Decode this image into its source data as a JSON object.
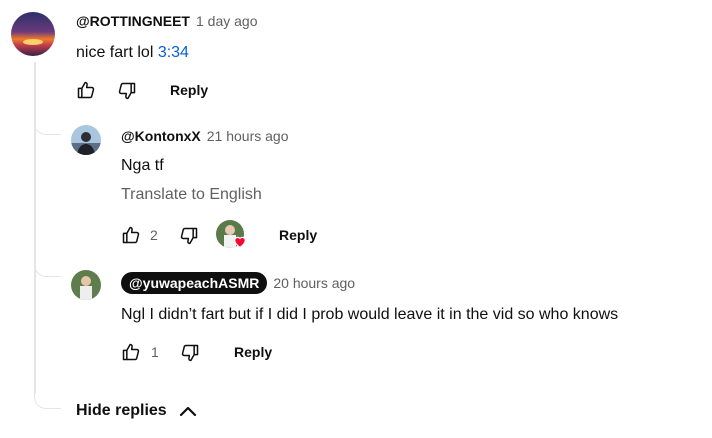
{
  "main_comment": {
    "author": "@ROTTINGNEET",
    "time": "1 day ago",
    "text": "nice fart lol ",
    "timestamp_link": "3:34",
    "reply_label": "Reply"
  },
  "replies": [
    {
      "author": "@KontonxX",
      "time": "21 hours ago",
      "text": "Nga tf",
      "translate": "Translate to English",
      "likes": "2",
      "reply_label": "Reply"
    },
    {
      "author": "@yuwapeachASMR",
      "time": "20 hours ago",
      "text": "Ngl I didn’t fart but if I did I prob would leave it in the vid so who knows",
      "likes": "1",
      "reply_label": "Reply"
    }
  ],
  "hide_replies": "Hide replies",
  "colors": {
    "link": "#065fd4",
    "heart": "#ff0033",
    "secondary_text": "#606060",
    "creator_chip": "#0f0f0f"
  },
  "icons": [
    "thumbs-up-icon",
    "thumbs-down-icon",
    "heart-icon",
    "chevron-up-icon"
  ]
}
